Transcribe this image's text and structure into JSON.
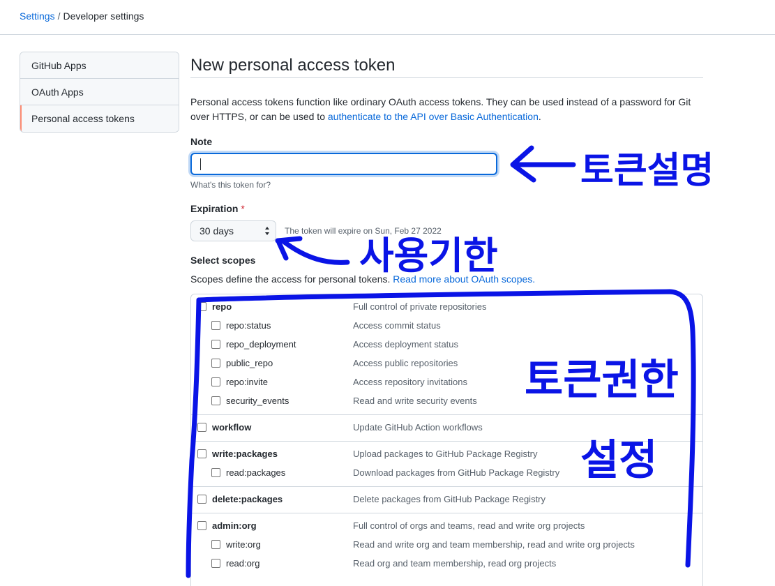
{
  "breadcrumb": {
    "root": "Settings",
    "separator": "/",
    "current": "Developer settings"
  },
  "sidebar": {
    "items": [
      {
        "label": "GitHub Apps",
        "active": false
      },
      {
        "label": "OAuth Apps",
        "active": false
      },
      {
        "label": "Personal access tokens",
        "active": true
      }
    ]
  },
  "page": {
    "title": "New personal access token",
    "description_prefix": "Personal access tokens function like ordinary OAuth access tokens. They can be used instead of a password for Git over HTTPS, or can be used to ",
    "description_link": "authenticate to the API over Basic Authentication",
    "description_suffix": "."
  },
  "note": {
    "label": "Note",
    "value": "",
    "hint": "What's this token for?"
  },
  "expiration": {
    "label": "Expiration",
    "required_marker": "*",
    "selected": "30 days",
    "note": "The token will expire on Sun, Feb 27 2022"
  },
  "scopes": {
    "heading": "Select scopes",
    "description_prefix": "Scopes define the access for personal tokens. ",
    "description_link": "Read more about OAuth scopes.",
    "groups": [
      {
        "name": "repo",
        "desc": "Full control of private repositories",
        "children": [
          {
            "name": "repo:status",
            "desc": "Access commit status"
          },
          {
            "name": "repo_deployment",
            "desc": "Access deployment status"
          },
          {
            "name": "public_repo",
            "desc": "Access public repositories"
          },
          {
            "name": "repo:invite",
            "desc": "Access repository invitations"
          },
          {
            "name": "security_events",
            "desc": "Read and write security events"
          }
        ]
      },
      {
        "name": "workflow",
        "desc": "Update GitHub Action workflows",
        "children": []
      },
      {
        "name": "write:packages",
        "desc": "Upload packages to GitHub Package Registry",
        "children": [
          {
            "name": "read:packages",
            "desc": "Download packages from GitHub Package Registry"
          }
        ]
      },
      {
        "name": "delete:packages",
        "desc": "Delete packages from GitHub Package Registry",
        "children": []
      },
      {
        "name": "admin:org",
        "desc": "Full control of orgs and teams, read and write org projects",
        "children": [
          {
            "name": "write:org",
            "desc": "Read and write org and team membership, read and write org projects"
          },
          {
            "name": "read:org",
            "desc": "Read org and team membership, read org projects"
          }
        ]
      }
    ]
  },
  "annotations": {
    "color": "#0a14e6",
    "note_arrow_text": "토큰설명",
    "expiration_arrow_text": "사용기한",
    "scopes_text_line1": "토큰권한",
    "scopes_text_line2": "설정"
  },
  "colors": {
    "link": "#0969da",
    "focus": "#0969da",
    "active_nav": "#fd8c73",
    "required": "#cf222e"
  }
}
